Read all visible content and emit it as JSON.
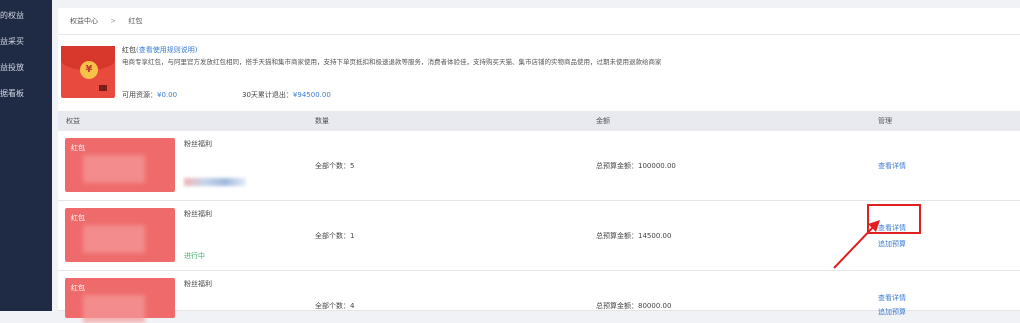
{
  "sidebar": {
    "items": [
      {
        "label": "的权益"
      },
      {
        "label": "益采买"
      },
      {
        "label": "益投放"
      },
      {
        "label": "据看板"
      }
    ]
  },
  "breadcrumb": {
    "root": "权益中心",
    "separator": ">",
    "current": "红包"
  },
  "summary": {
    "title": "红包",
    "title_link": "(查看使用规则说明)",
    "description": "电商专享红包，与阿里官方发放红包相同，搭手天猫和集市商家使用，支持下单页抵扣和极速退款等服务，消费者体验佳，支持购买天猫、集市店铺的实物商品使用，过期未使用退款给商家",
    "balance_label": "可用资源：",
    "balance_value": "¥0.00",
    "outflow_label": "30天累计退出：",
    "outflow_value": "¥94500.00",
    "icon": "red-envelope-yen"
  },
  "table": {
    "headers": [
      "权益",
      "数量",
      "金额",
      "管理"
    ],
    "rows": [
      {
        "card_label": "红包",
        "name": "粉丝福利",
        "status": "",
        "count": "全部个数：5",
        "budget": "总预算金额：100000.00",
        "actions": [
          "查看详情"
        ]
      },
      {
        "card_label": "红包",
        "name": "粉丝福利",
        "status": "进行中",
        "count": "全部个数：1",
        "budget": "总预算金额：14500.00",
        "actions": [
          "查看详情",
          "追加预算"
        ]
      },
      {
        "card_label": "红包",
        "name": "粉丝福利",
        "status": "",
        "count": "全部个数：4",
        "budget": "总预算金额：80000.00",
        "actions": [
          "查看详情",
          "追加预算"
        ]
      }
    ]
  },
  "colors": {
    "sidebar_bg": "#1f2a44",
    "accent": "#3a7bd5",
    "card_red": "#ef6b6b",
    "status_green": "#38b26a",
    "highlight": "#e02020"
  }
}
